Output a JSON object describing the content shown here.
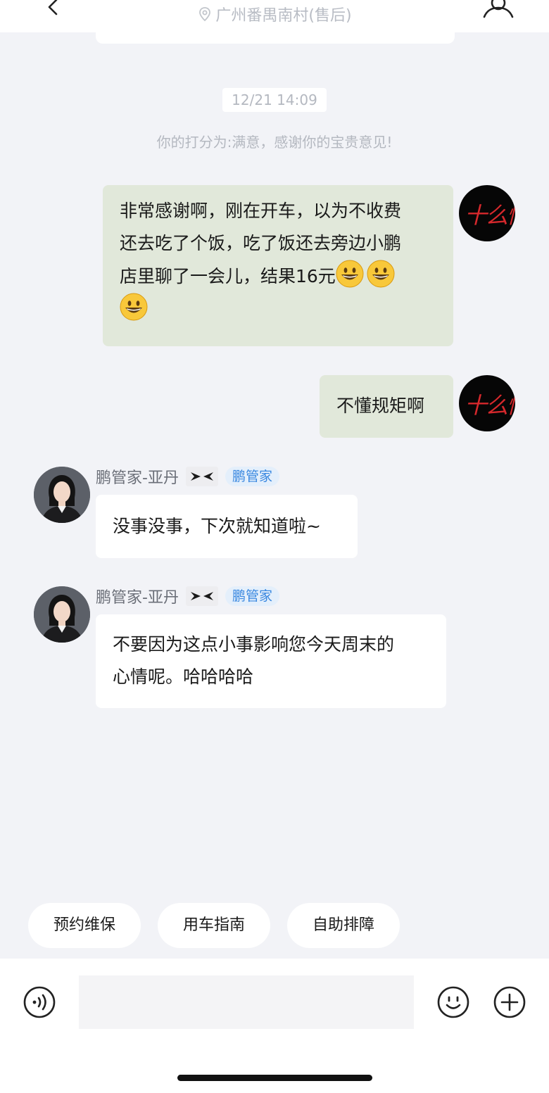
{
  "header": {
    "location": "广州番禺南村(售后)"
  },
  "chat": {
    "timestamp": "12/21 14:09",
    "rating_note": "你的打分为:满意，感谢你的宝贵意见!",
    "messages": [
      {
        "from": "me",
        "lines": [
          "非常感谢啊，刚在开车，以为不收费",
          "还去吃了个饭，吃了饭还去旁边小鹏",
          "店里聊了一会儿，结果16元"
        ],
        "emoji": "grinning-face-emoji",
        "emoji_count": 3
      },
      {
        "from": "me",
        "text": "不懂规矩啊"
      },
      {
        "from": "agent",
        "sender": "鹏管家-亚丹",
        "role_tag": "鹏管家",
        "text": "没事没事，下次就知道啦~"
      },
      {
        "from": "agent",
        "sender": "鹏管家-亚丹",
        "role_tag": "鹏管家",
        "lines": [
          "不要因为这点小事影响您今天周末的",
          "心情呢。哈哈哈哈"
        ]
      }
    ],
    "my_avatar_sig": "十么情况"
  },
  "quick_actions": [
    "预约维保",
    "用车指南",
    "自助排障"
  ],
  "composer": {
    "input_value": "",
    "icons": [
      "voice-icon",
      "emoji-icon",
      "plus-icon"
    ]
  },
  "colors": {
    "bg": "#f2f3f7",
    "my_bubble": "#e1e8da",
    "tag_blue": "#3a88e0"
  }
}
